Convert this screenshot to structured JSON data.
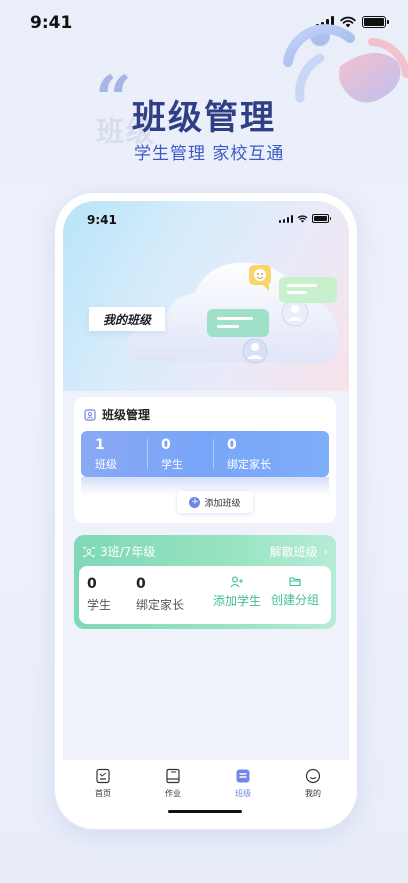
{
  "status_bar": {
    "time": "9:41"
  },
  "banner": {
    "quote_mark": "“",
    "ghost_text": "班级",
    "title": "班级管理",
    "subtitle": "学生管理 家校互通"
  },
  "phone": {
    "status_time": "9:41",
    "hero_tag": "我的班级",
    "class_management": {
      "title": "班级管理",
      "stats": [
        {
          "value": "1",
          "label": "班级"
        },
        {
          "value": "0",
          "label": "学生"
        },
        {
          "value": "0",
          "label": "绑定家长"
        }
      ],
      "add_button": "添加班级"
    },
    "class_card": {
      "name": "3班/7年级",
      "dissolve": "解散班级",
      "stats": [
        {
          "value": "0",
          "label": "学生"
        },
        {
          "value": "0",
          "label": "绑定家长"
        }
      ],
      "actions": [
        {
          "label": "添加学生",
          "icon": "add-person-icon"
        },
        {
          "label": "创建分组",
          "icon": "folder-icon"
        }
      ]
    },
    "tabbar": [
      {
        "label": "首页",
        "icon": "home-doc-icon",
        "active": false
      },
      {
        "label": "作业",
        "icon": "book-icon",
        "active": false
      },
      {
        "label": "班级",
        "icon": "class-list-icon",
        "active": true
      },
      {
        "label": "我的",
        "icon": "profile-face-icon",
        "active": false
      }
    ]
  },
  "colors": {
    "title": "#2f3f86",
    "subtitle": "#3e58c8",
    "stats_blue": "#7ea6f8",
    "class_green": "#7fd8b6",
    "accent": "#6f88e6"
  }
}
